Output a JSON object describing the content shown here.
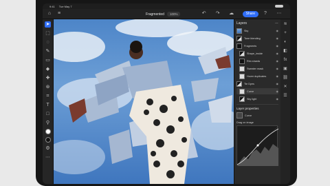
{
  "statusbar": {
    "time": "9:41",
    "date": "Tue May 7"
  },
  "topbar": {
    "document_name": "Fragmented",
    "zoom": "100%",
    "share_label": "Share"
  },
  "layers_panel": {
    "title": "Layers",
    "items": [
      {
        "label": "Sky",
        "thumb": "sky",
        "indent": 0
      },
      {
        "label": "Tone blending",
        "thumb": "mix",
        "indent": 0
      },
      {
        "label": "Fragments",
        "thumb": "black",
        "indent": 0
      },
      {
        "label": "Shape_inside",
        "thumb": "mix",
        "indent": 1
      },
      {
        "label": "Rim shards",
        "thumb": "black",
        "indent": 1
      },
      {
        "label": "Sweater mask",
        "thumb": "white",
        "indent": 1
      },
      {
        "label": "Hover duplicates",
        "thumb": "white",
        "indent": 1
      },
      {
        "label": "Tie Dyes",
        "thumb": "mix",
        "indent": 0
      },
      {
        "label": "Curve",
        "thumb": "white",
        "indent": 1
      },
      {
        "label": "Sky light",
        "thumb": "mix",
        "indent": 1
      }
    ]
  },
  "layer_properties": {
    "title": "Layer properties",
    "layer_name": "Curve",
    "curves_label": "Drag on image"
  },
  "colors": {
    "accent": "#2f6df6",
    "ui_bg": "#1e1e1e"
  }
}
